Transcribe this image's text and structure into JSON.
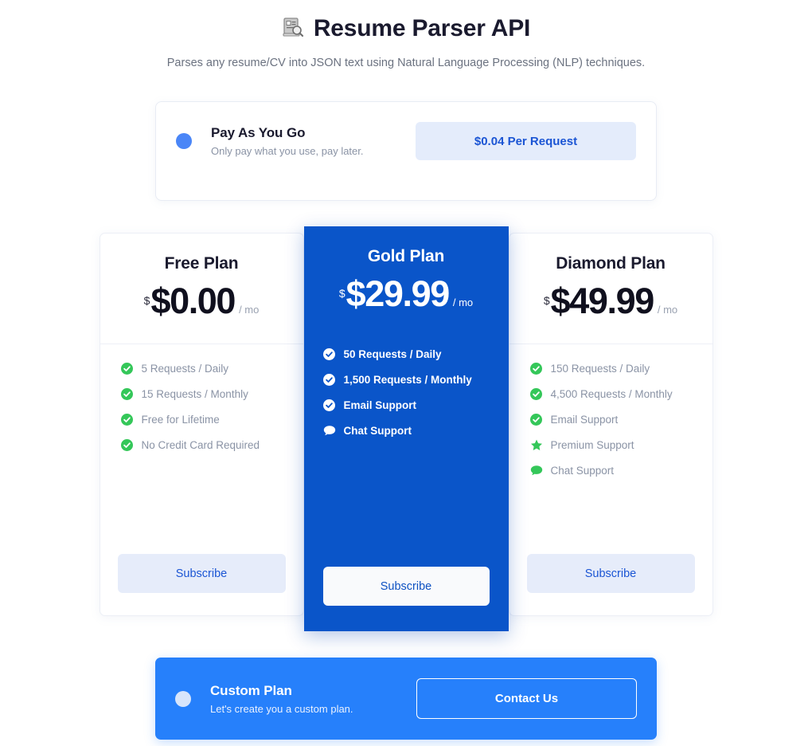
{
  "header": {
    "emoji": "🖼",
    "emoji_name": "resume-scan-icon",
    "title": "Resume Parser API",
    "subtitle": "Parses any resume/CV into JSON text using Natural Language Processing (NLP) techniques."
  },
  "pay_as_you_go": {
    "name": "Pay As You Go",
    "description": "Only pay what you use, pay later.",
    "rate_label": "$0.04 Per Request",
    "dot_color": "#4a86f7",
    "pill_bg": "#e4ecfb",
    "pill_text_color": "#1b55d4"
  },
  "plans": [
    {
      "name": "Free Plan",
      "currency_sup": "$",
      "price": "$0.00",
      "period": "/ mo",
      "featured": false,
      "button_label": "Subscribe",
      "features": [
        {
          "icon": "check-circle-icon",
          "label": "5 Requests / Daily"
        },
        {
          "icon": "check-circle-icon",
          "label": "15 Requests / Monthly"
        },
        {
          "icon": "check-circle-icon",
          "label": "Free for Lifetime"
        },
        {
          "icon": "check-circle-icon",
          "label": "No Credit Card Required"
        }
      ]
    },
    {
      "name": "Gold Plan",
      "currency_sup": "$",
      "price": "$29.99",
      "period": "/ mo",
      "featured": true,
      "button_label": "Subscribe",
      "features": [
        {
          "icon": "check-circle-icon",
          "label": "50 Requests / Daily"
        },
        {
          "icon": "check-circle-icon",
          "label": "1,500 Requests / Monthly"
        },
        {
          "icon": "check-circle-icon",
          "label": "Email Support"
        },
        {
          "icon": "chat-bubble-icon",
          "label": "Chat Support"
        }
      ]
    },
    {
      "name": "Diamond Plan",
      "currency_sup": "$",
      "price": "$49.99",
      "period": "/ mo",
      "featured": false,
      "button_label": "Subscribe",
      "features": [
        {
          "icon": "check-circle-icon",
          "label": "150 Requests / Daily"
        },
        {
          "icon": "check-circle-icon",
          "label": "4,500 Requests / Monthly"
        },
        {
          "icon": "check-circle-icon",
          "label": "Email Support"
        },
        {
          "icon": "star-icon",
          "label": "Premium Support"
        },
        {
          "icon": "chat-bubble-icon",
          "label": "Chat Support"
        }
      ]
    }
  ],
  "custom_plan": {
    "name": "Custom Plan",
    "description": "Let's create you a custom plan.",
    "button_label": "Contact Us",
    "card_bg": "#2680fb",
    "dot_color": "#d7e5fb"
  },
  "colors": {
    "featured_card": "#0a55c9",
    "accent_blue": "#1b55d4",
    "check_green": "#34c759",
    "page_bg": "#ffffff"
  }
}
